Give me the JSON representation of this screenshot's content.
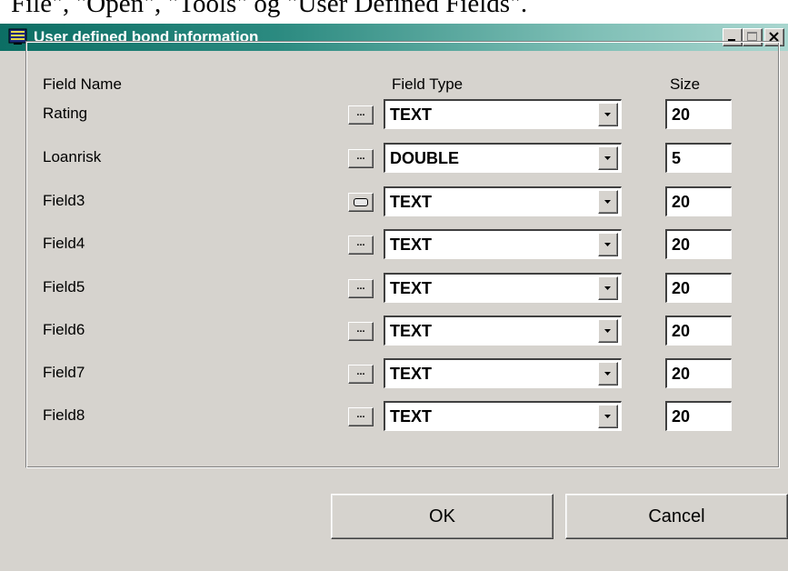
{
  "caption_above": "File\", \"Open\", \"Tools\" og \"User Defined Fields\".",
  "window": {
    "title": "User defined bond information",
    "controls": {
      "minimize": "minimize-icon",
      "maximize": "maximize-icon",
      "close": "close-icon"
    },
    "title_gradient": [
      "#0c6e64",
      "#a9d6cf"
    ]
  },
  "headers": {
    "field_name": "Field Name",
    "field_type": "Field Type",
    "size": "Size"
  },
  "ellipsis_label": "...",
  "rows": [
    {
      "name": "Rating",
      "type": "TEXT",
      "size": "20"
    },
    {
      "name": "Loanrisk",
      "type": "DOUBLE",
      "size": "5"
    },
    {
      "name": "Field3",
      "type": "TEXT",
      "size": "20"
    },
    {
      "name": "Field4",
      "type": "TEXT",
      "size": "20"
    },
    {
      "name": "Field5",
      "type": "TEXT",
      "size": "20"
    },
    {
      "name": "Field6",
      "type": "TEXT",
      "size": "20"
    },
    {
      "name": "Field7",
      "type": "TEXT",
      "size": "20"
    },
    {
      "name": "Field8",
      "type": "TEXT",
      "size": "20"
    }
  ],
  "buttons": {
    "ok": "OK",
    "cancel": "Cancel"
  }
}
